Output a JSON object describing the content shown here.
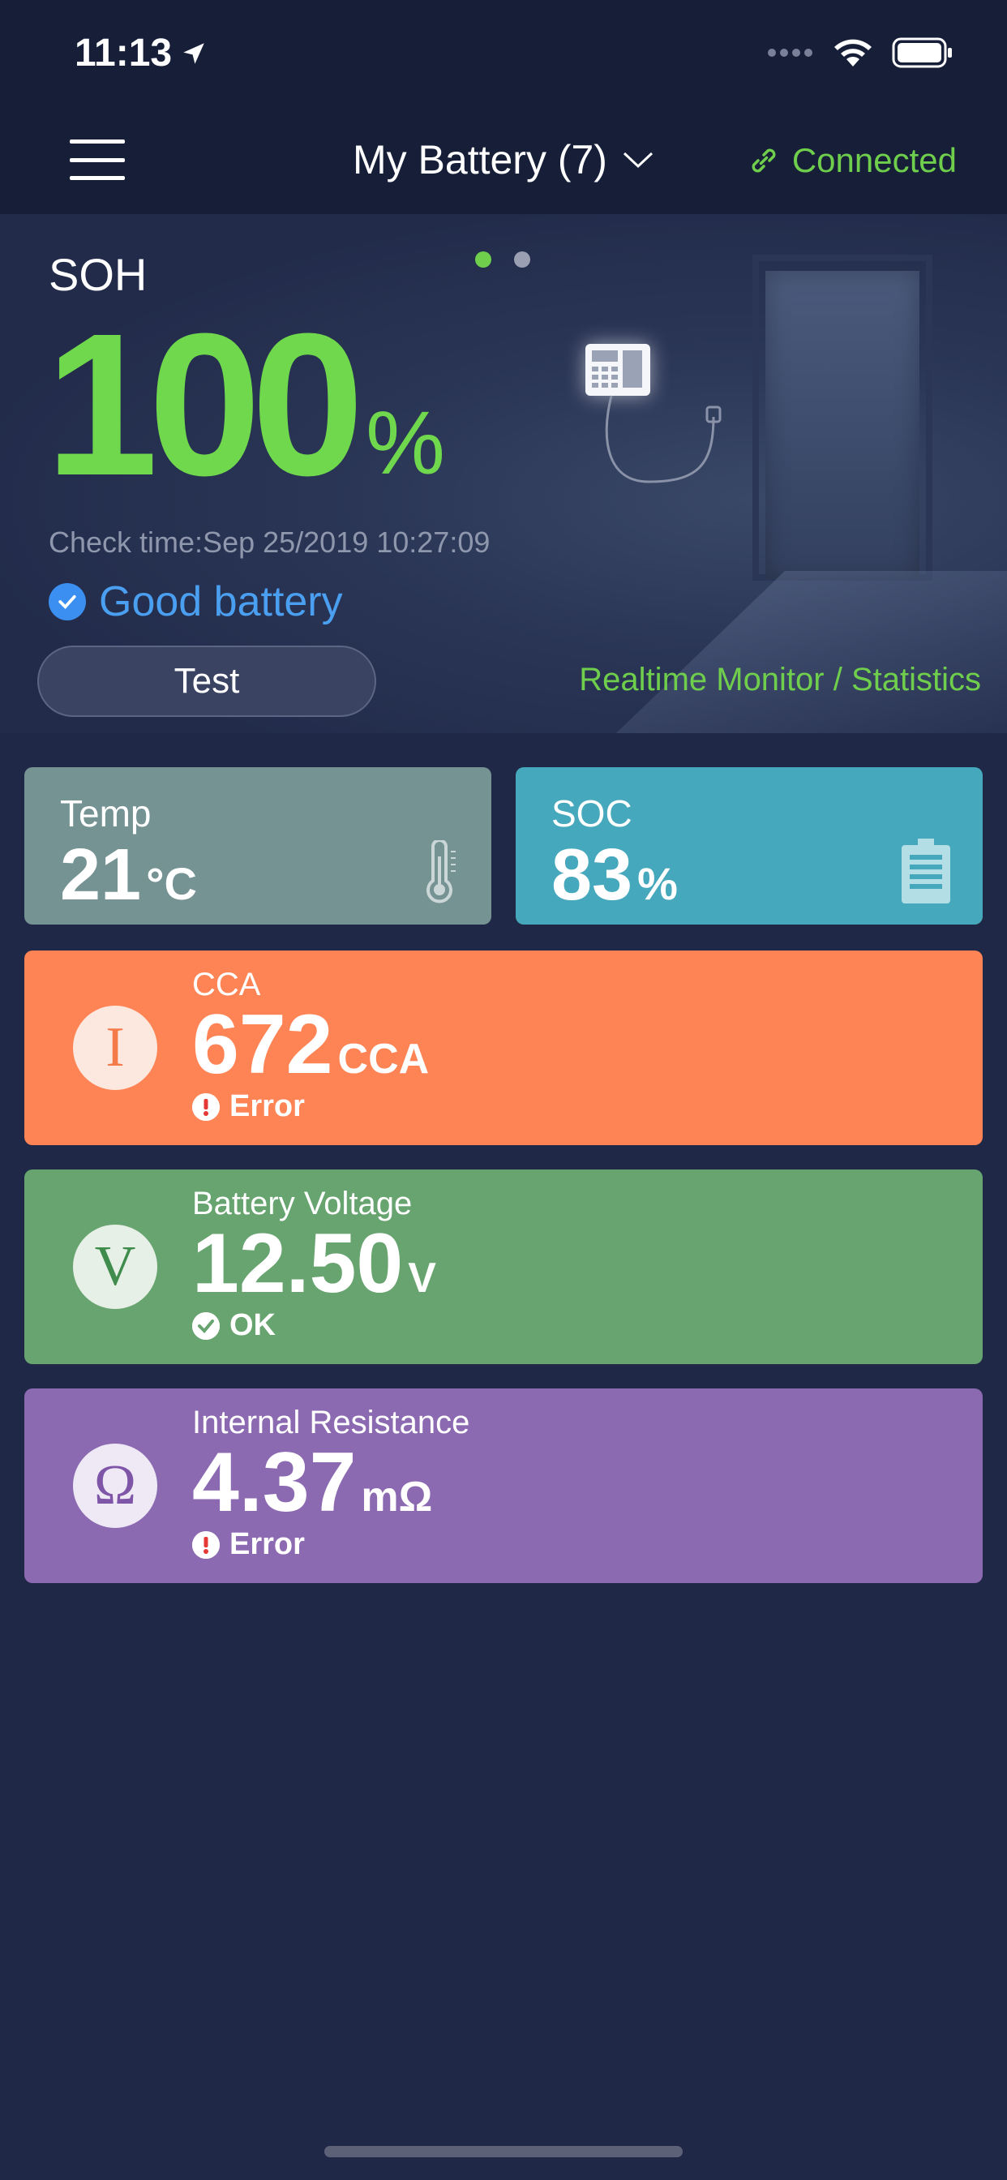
{
  "status_bar": {
    "time": "11:13",
    "icons": [
      "location-arrow-icon",
      "cellular-signal-icon",
      "wifi-icon",
      "battery-icon"
    ]
  },
  "nav": {
    "title": "My Battery (7)",
    "connection_status": "Connected",
    "icons": [
      "hamburger-menu-icon",
      "chevron-down-icon",
      "link-icon"
    ]
  },
  "hero": {
    "soh_label": "SOH",
    "soh_value": "100",
    "soh_unit": "%",
    "check_time": "Check time:Sep 25/2019 10:27:09",
    "battery_status": "Good battery",
    "test_button": "Test",
    "realtime_link": "Realtime Monitor / Statistics",
    "page_indicator": {
      "current": 1,
      "total": 2
    }
  },
  "tiles": {
    "temp": {
      "label": "Temp",
      "value": "21",
      "unit": "°C",
      "icon": "thermometer-icon"
    },
    "soc": {
      "label": "SOC",
      "value": "83",
      "unit": "%",
      "icon": "battery-level-icon"
    }
  },
  "metrics": {
    "cca": {
      "symbol": "I",
      "label": "CCA",
      "value": "672",
      "unit": "CCA",
      "status": "Error"
    },
    "voltage": {
      "symbol": "V",
      "label": "Battery Voltage",
      "value": "12.50",
      "unit": "V",
      "status": "OK"
    },
    "resistance": {
      "symbol": "Ω",
      "label": "Internal Resistance",
      "value": "4.37",
      "unit": "mΩ",
      "status": "Error"
    }
  },
  "colors": {
    "background": "#1f2847",
    "accent_green": "#6fcf4c",
    "accent_blue": "#4a9ff0",
    "temp_tile": "#769394",
    "soc_tile": "#45a8bc",
    "cca_tile": "#ff8455",
    "voltage_tile": "#67a470",
    "resistance_tile": "#8c6ab1",
    "error_icon": "#e53935"
  }
}
